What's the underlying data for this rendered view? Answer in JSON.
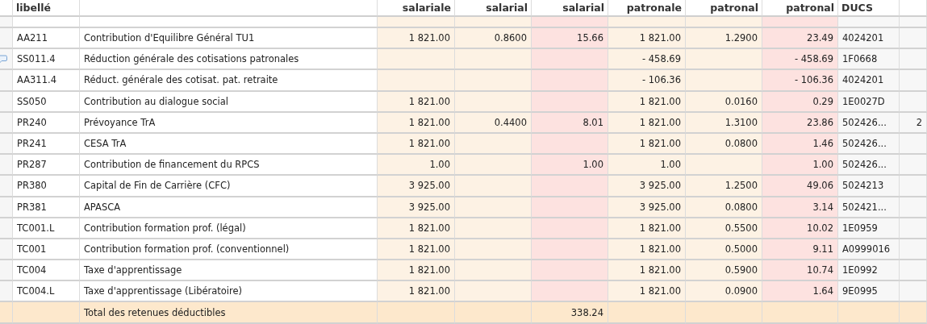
{
  "table": {
    "headers": {
      "code": "libellé",
      "column_3": "salariale",
      "column_4": "salarial",
      "column_5": "salarial",
      "column_6": "patronale",
      "column_7": "patronal",
      "column_8": "patronal",
      "ducs": "DUCS"
    },
    "rows": [
      {
        "kind": "line",
        "comment": false,
        "cells": {
          "code": "AA211",
          "label": "Contribution d'Equilibre Général TU1",
          "column_3": "1 821.00",
          "column_4": "0.8600",
          "column_5": "15.66",
          "column_6": "1 821.00",
          "column_7": "1.2900",
          "column_8": "23.49",
          "ducs": "4024201"
        }
      },
      {
        "kind": "line",
        "comment": true,
        "cells": {
          "code": "SS011.4",
          "label": "Réduction générale des cotisations patronales",
          "column_6": "- 458.69",
          "column_8": "- 458.69",
          "ducs": "1F0668"
        }
      },
      {
        "kind": "line",
        "comment": false,
        "cells": {
          "code": "AA311.4",
          "label": "Réduct. générale des cotisat. pat. retraite",
          "column_6": "- 106.36",
          "column_8": "- 106.36",
          "ducs": "4024201"
        }
      },
      {
        "kind": "line",
        "comment": false,
        "cells": {
          "code": "SS050",
          "label": "Contribution au dialogue social",
          "column_3": "1 821.00",
          "column_6": "1 821.00",
          "column_7": "0.0160",
          "column_8": "0.29",
          "ducs": "1E0027D"
        }
      },
      {
        "kind": "line",
        "comment": false,
        "cells": {
          "code": "PR240",
          "label": "Prévoyance TrA",
          "column_3": "1 821.00",
          "column_4": "0.4400",
          "column_5": "8.01",
          "column_6": "1 821.00",
          "column_7": "1.3100",
          "column_8": "23.86",
          "ducs": "502426...",
          "column_10": "2"
        }
      },
      {
        "kind": "line",
        "comment": false,
        "cells": {
          "code": "PR241",
          "label": "CESA TrA",
          "column_3": "1 821.00",
          "column_6": "1 821.00",
          "column_7": "0.0800",
          "column_8": "1.46",
          "ducs": "502426..."
        }
      },
      {
        "kind": "line",
        "comment": false,
        "cells": {
          "code": "PR287",
          "label": "Contribution de financement du RPCS",
          "column_3": "1.00",
          "column_5": "1.00",
          "column_6": "1.00",
          "column_8": "1.00",
          "ducs": "502426..."
        }
      },
      {
        "kind": "line",
        "comment": false,
        "cells": {
          "code": "PR380",
          "label": "Capital de Fin de Carrière (CFC)",
          "column_3": "3 925.00",
          "column_6": "3 925.00",
          "column_7": "1.2500",
          "column_8": "49.06",
          "ducs": "5024213"
        }
      },
      {
        "kind": "line",
        "comment": false,
        "cells": {
          "code": "PR381",
          "label": "APASCA",
          "column_3": "3 925.00",
          "column_6": "3 925.00",
          "column_7": "0.0800",
          "column_8": "3.14",
          "ducs": "502421..."
        }
      },
      {
        "kind": "line",
        "comment": false,
        "cells": {
          "code": "TC001.L",
          "label": "Contribution formation prof. (légal)",
          "column_3": "1 821.00",
          "column_6": "1 821.00",
          "column_7": "0.5500",
          "column_8": "10.02",
          "ducs": "1E0959"
        }
      },
      {
        "kind": "line",
        "comment": false,
        "cells": {
          "code": "TC001",
          "label": "Contribution formation prof. (conventionnel)",
          "column_3": "1 821.00",
          "column_6": "1 821.00",
          "column_7": "0.5000",
          "column_8": "9.11",
          "ducs": "A0999016"
        }
      },
      {
        "kind": "line",
        "comment": false,
        "cells": {
          "code": "TC004",
          "label": "Taxe d'apprentissage",
          "column_3": "1 821.00",
          "column_6": "1 821.00",
          "column_7": "0.5900",
          "column_8": "10.74",
          "ducs": "1E0992"
        }
      },
      {
        "kind": "line",
        "comment": false,
        "cells": {
          "code": "TC004.L",
          "label": "Taxe d'apprentissage (Libératoire)",
          "column_3": "1 821.00",
          "column_6": "1 821.00",
          "column_7": "0.0900",
          "column_8": "1.64",
          "ducs": "9E0995"
        }
      },
      {
        "kind": "total",
        "comment": false,
        "cells": {
          "label": "Total des retenues déductibles",
          "column_5": "338.24"
        }
      }
    ]
  }
}
